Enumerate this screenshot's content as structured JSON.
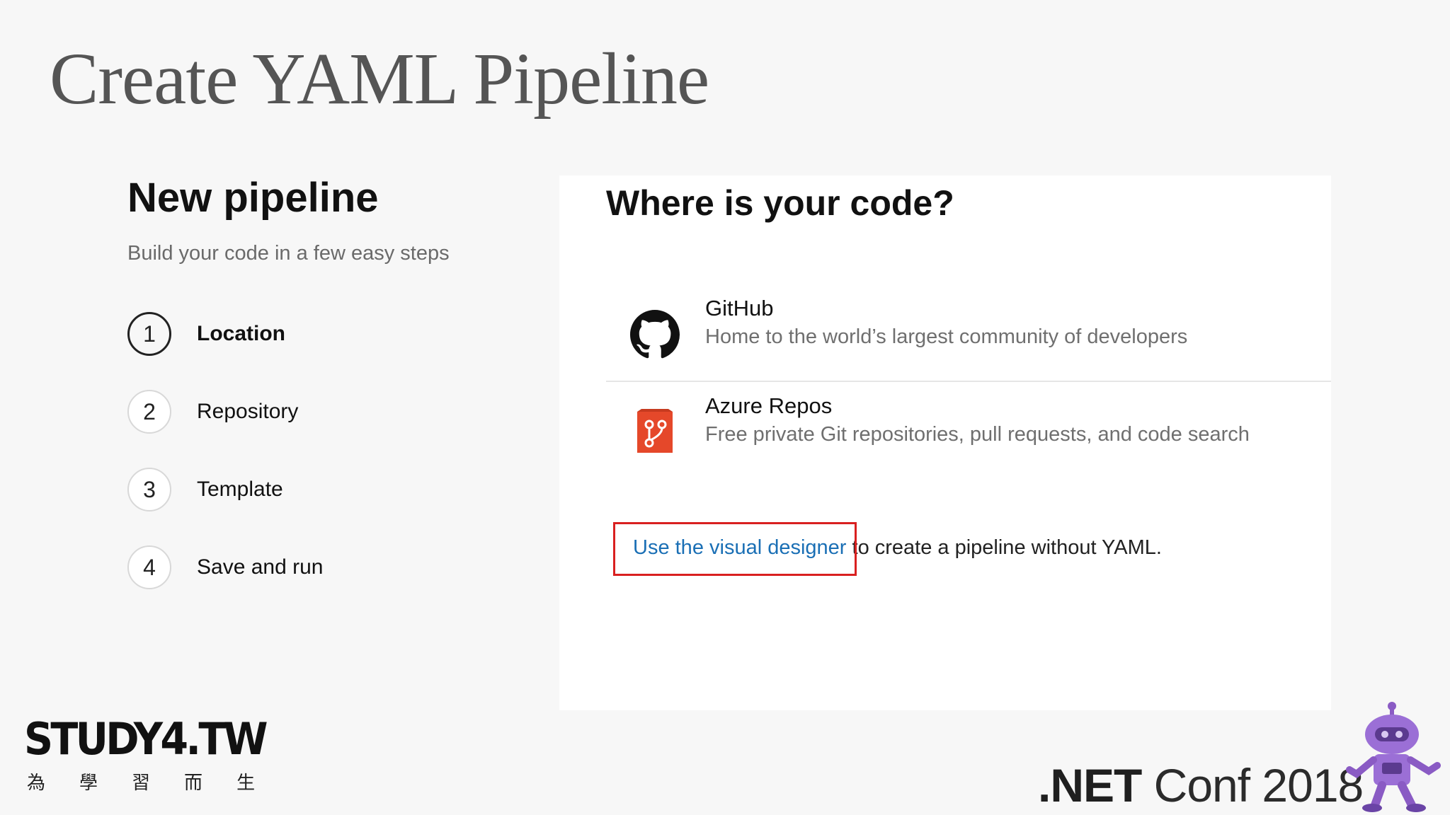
{
  "slide": {
    "title": "Create YAML Pipeline"
  },
  "wizard": {
    "heading": "New pipeline",
    "subtitle": "Build your code in a few easy steps",
    "steps": [
      {
        "number": "1",
        "label": "Location",
        "active": true
      },
      {
        "number": "2",
        "label": "Repository",
        "active": false
      },
      {
        "number": "3",
        "label": "Template",
        "active": false
      },
      {
        "number": "4",
        "label": "Save and run",
        "active": false
      }
    ]
  },
  "code_source": {
    "title": "Where is your code?",
    "options": [
      {
        "name": "GitHub",
        "description": "Home to the world’s largest community of developers",
        "icon": "github-icon"
      },
      {
        "name": "Azure Repos",
        "description": "Free private Git repositories, pull requests, and code search",
        "icon": "azure-repos-icon"
      }
    ],
    "designer_link": "Use the visual designer",
    "designer_text": " to create a pipeline without YAML."
  },
  "footer": {
    "logo_text": "STUDY4.TW",
    "logo_sub": [
      "為",
      "學",
      "習",
      "而",
      "生"
    ],
    "conf_brand": ".NET",
    "conf_name": " Conf 2018"
  },
  "colors": {
    "link": "#1a6fb5",
    "highlight": "#d92020",
    "azure": "#e5482a"
  }
}
